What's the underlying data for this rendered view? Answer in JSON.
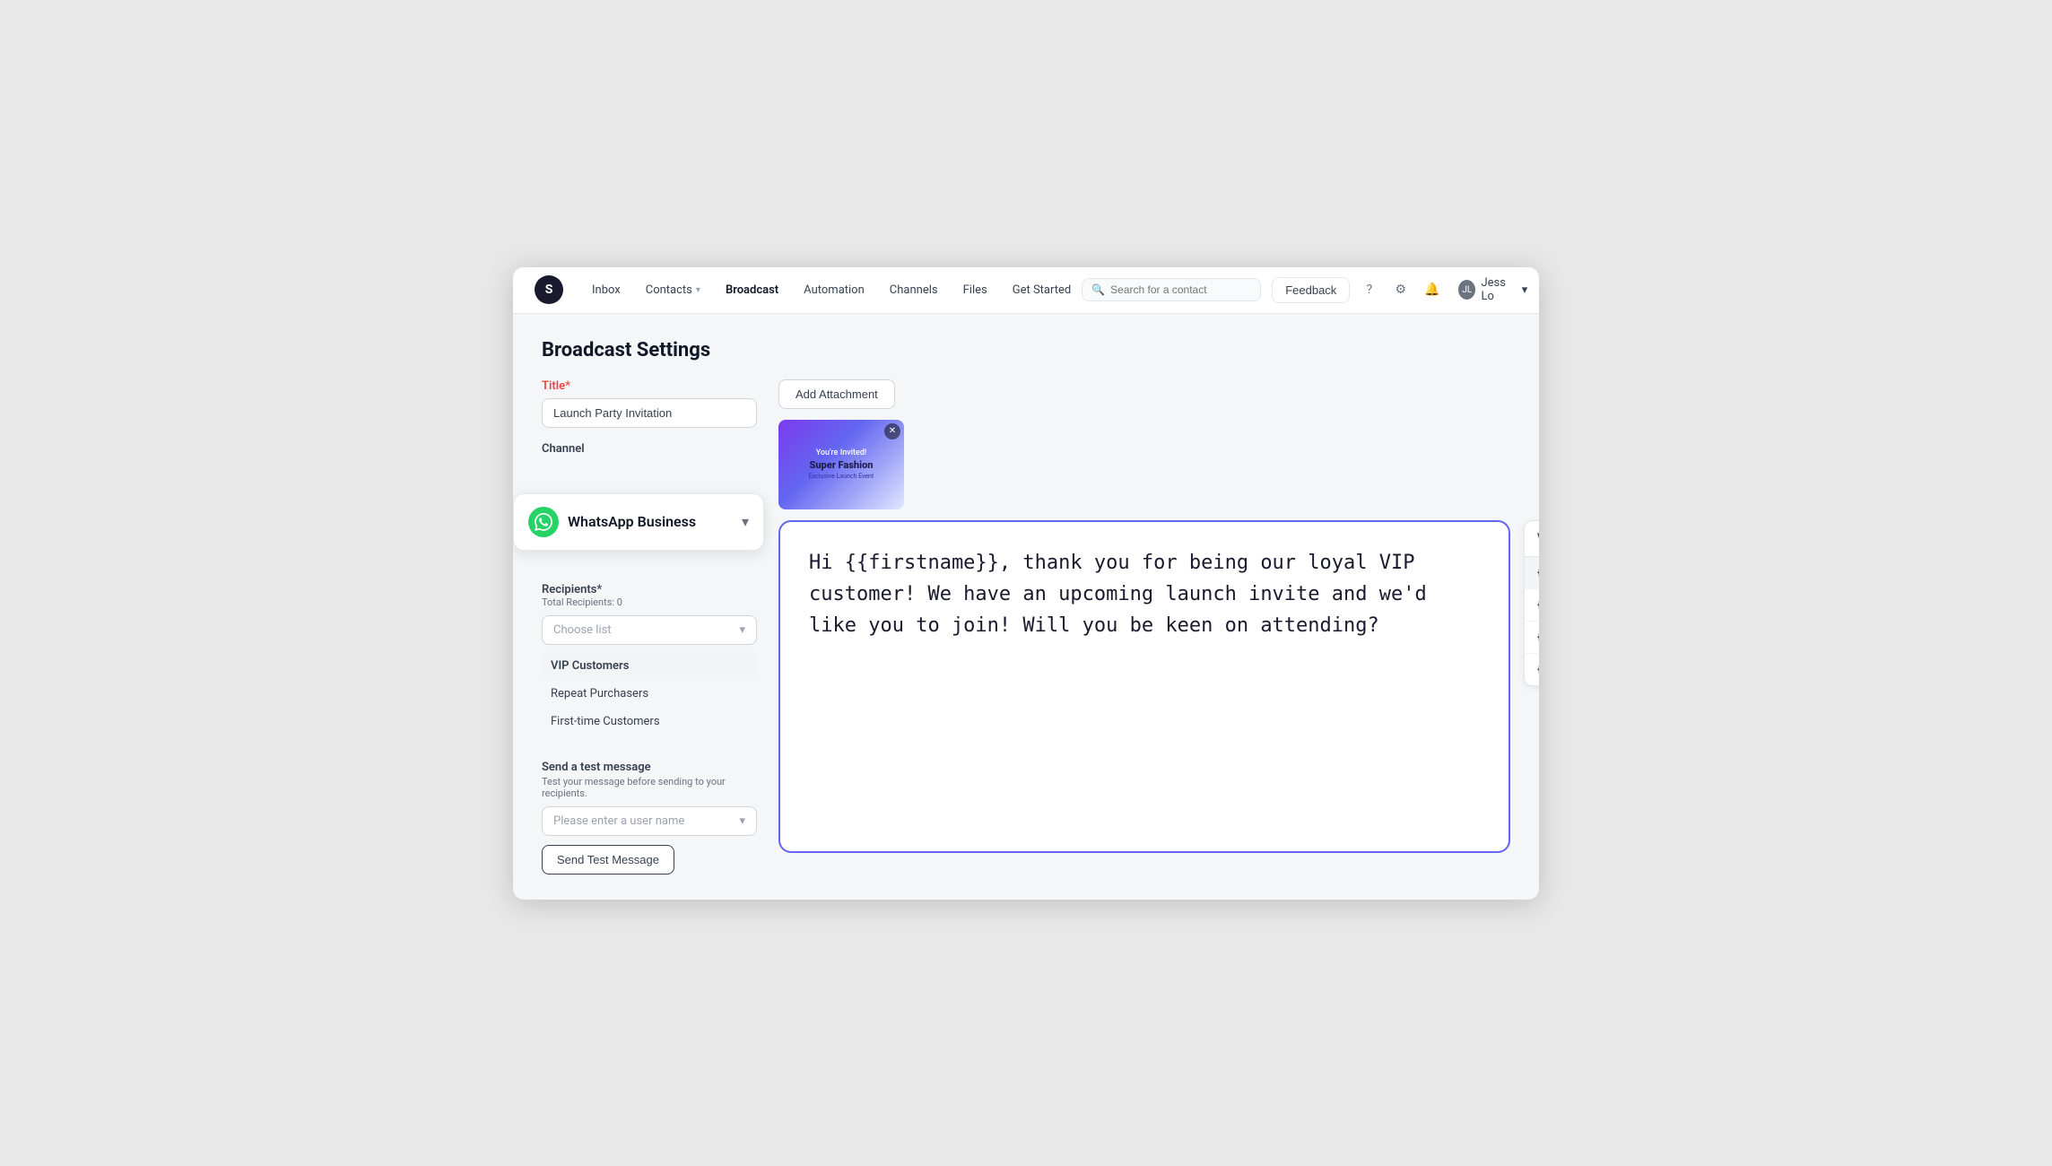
{
  "app": {
    "logo_letter": "S"
  },
  "navbar": {
    "links": [
      {
        "label": "Inbox",
        "active": false,
        "has_chevron": false
      },
      {
        "label": "Contacts",
        "active": false,
        "has_chevron": true
      },
      {
        "label": "Broadcast",
        "active": true,
        "has_chevron": false
      },
      {
        "label": "Automation",
        "active": false,
        "has_chevron": false
      },
      {
        "label": "Channels",
        "active": false,
        "has_chevron": false
      },
      {
        "label": "Files",
        "active": false,
        "has_chevron": false
      },
      {
        "label": "Get Started",
        "active": false,
        "has_chevron": false
      }
    ],
    "search_placeholder": "Search for a contact",
    "feedback_label": "Feedback",
    "user_name": "Jess Lo"
  },
  "page": {
    "title": "Broadcast Settings"
  },
  "form": {
    "title_label": "Title",
    "title_required": true,
    "title_value": "Launch Party Invitation",
    "channel_label": "Channel",
    "channel_name": "WhatsApp Business",
    "recipients_label": "Recipients",
    "recipients_required": true,
    "total_recipients_label": "Total Recipients: 0",
    "choose_list_placeholder": "Choose list",
    "recipient_lists": [
      {
        "label": "VIP Customers",
        "selected": true
      },
      {
        "label": "Repeat Purchasers",
        "selected": false
      },
      {
        "label": "First-time Customers",
        "selected": false
      }
    ],
    "test_message_title": "Send a test message",
    "test_message_sub": "Test your message before sending to your recipients.",
    "test_message_placeholder": "Please enter a user name",
    "send_test_label": "Send Test Message",
    "add_attachment_label": "Add Attachment"
  },
  "image_preview": {
    "invited_text": "You're Invited!",
    "brand_name": "Super Fashion",
    "sub_text": "Exclusive Launch Event"
  },
  "message": {
    "content": "Hi {{firstname}}, thank you for being our loyal VIP customer! We have an upcoming launch invite and we'd like you to join! Will you be keen on attending?"
  },
  "variables": {
    "header": "Variables",
    "items": [
      {
        "label": "{{firstname}}",
        "active": true
      },
      {
        "label": "{{lastname}}",
        "active": false
      },
      {
        "label": "{{phonenumber}}",
        "active": false
      },
      {
        "label": "{{companyname}}",
        "active": false
      }
    ]
  }
}
